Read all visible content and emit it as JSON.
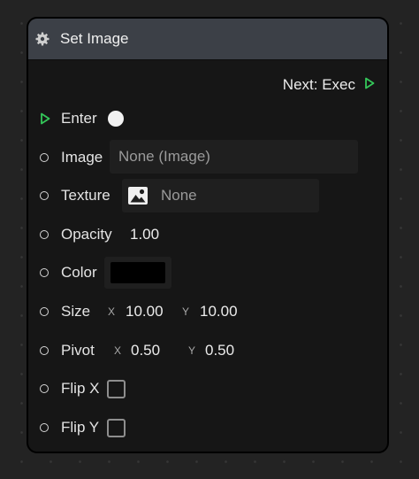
{
  "node": {
    "title": "Set Image",
    "header_icon": "gear-icon",
    "next_label": "Next: Exec",
    "exec_pin_color": "#34c759",
    "enter_label": "Enter",
    "image": {
      "label": "Image",
      "value": "None (Image)"
    },
    "texture": {
      "label": "Texture",
      "value": "None",
      "icon": "image-icon"
    },
    "opacity": {
      "label": "Opacity",
      "value": "1.00"
    },
    "color": {
      "label": "Color",
      "swatch": "#000000"
    },
    "size": {
      "label": "Size",
      "x_label": "X",
      "x_value": "10.00",
      "y_label": "Y",
      "y_value": "10.00"
    },
    "pivot": {
      "label": "Pivot",
      "x_label": "X",
      "x_value": "0.50",
      "y_label": "Y",
      "y_value": "0.50"
    },
    "flip_x": {
      "label": "Flip X",
      "checked": false
    },
    "flip_y": {
      "label": "Flip Y",
      "checked": false
    }
  }
}
